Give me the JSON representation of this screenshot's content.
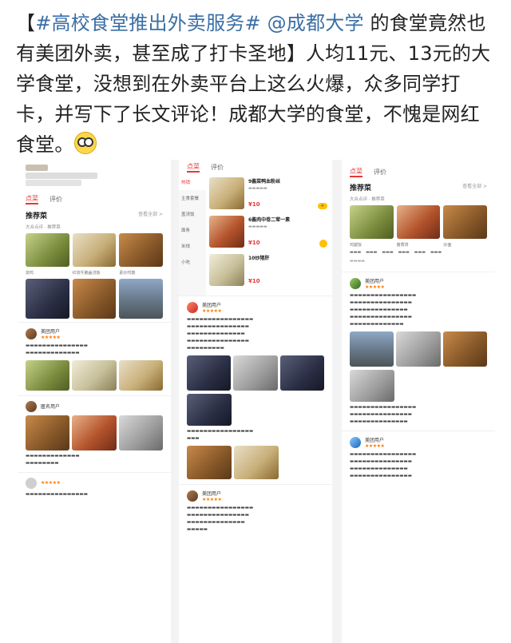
{
  "post": {
    "bracket_open": "【",
    "hashtag": "#高校食堂推出外卖服务#",
    "mention": "@成都大学",
    "text_1": " 的食堂竟然也有美团外卖，甚至成了打卡圣地",
    "bracket_close": "】",
    "text_2": "人均11元、13元的大学食堂，没想到在外卖平台上这么火爆，众多同学打卡，并写下了长文评论！成都大学的食堂，不愧是网红食堂。",
    "emoji": "dazed-face-emoji"
  },
  "screenshots": {
    "col1": {
      "tabs": [
        "点菜",
        "评价"
      ],
      "section_title": "推荐菜",
      "section_more": "查看全部 >",
      "subline": "大众点评 · 推荐菜",
      "food_captions": [
        "烧鸡",
        "红烧牛腩盖浇饭",
        "素炒时蔬"
      ],
      "review_names": [
        "美团用户",
        "匿名用户"
      ]
    },
    "col2": {
      "tabs": [
        "点菜",
        "评价"
      ],
      "side_nav": [
        "热销",
        "主食套餐",
        "盖浇饭",
        "面条",
        "米线",
        "小吃"
      ],
      "dish_1": "9酱菜鸭血粉丝",
      "dish_1_price": "¥10",
      "dish_2": "6酱肉中卷二荤一素",
      "dish_2_price": "¥10",
      "dish_3": "10炒猪肝",
      "dish_3_price": "¥10",
      "review_names": [
        "美团用户",
        "美团用户"
      ]
    },
    "col3": {
      "tabs": [
        "点菜",
        "评价"
      ],
      "section_title": "推荐菜",
      "section_more": "查看全部 >",
      "subline": "大众点评 · 推荐菜",
      "food_captions": [
        "鸡腿饭",
        "酱香饼",
        "炒面"
      ],
      "review_names": [
        "美团用户",
        "美团用户"
      ]
    }
  }
}
